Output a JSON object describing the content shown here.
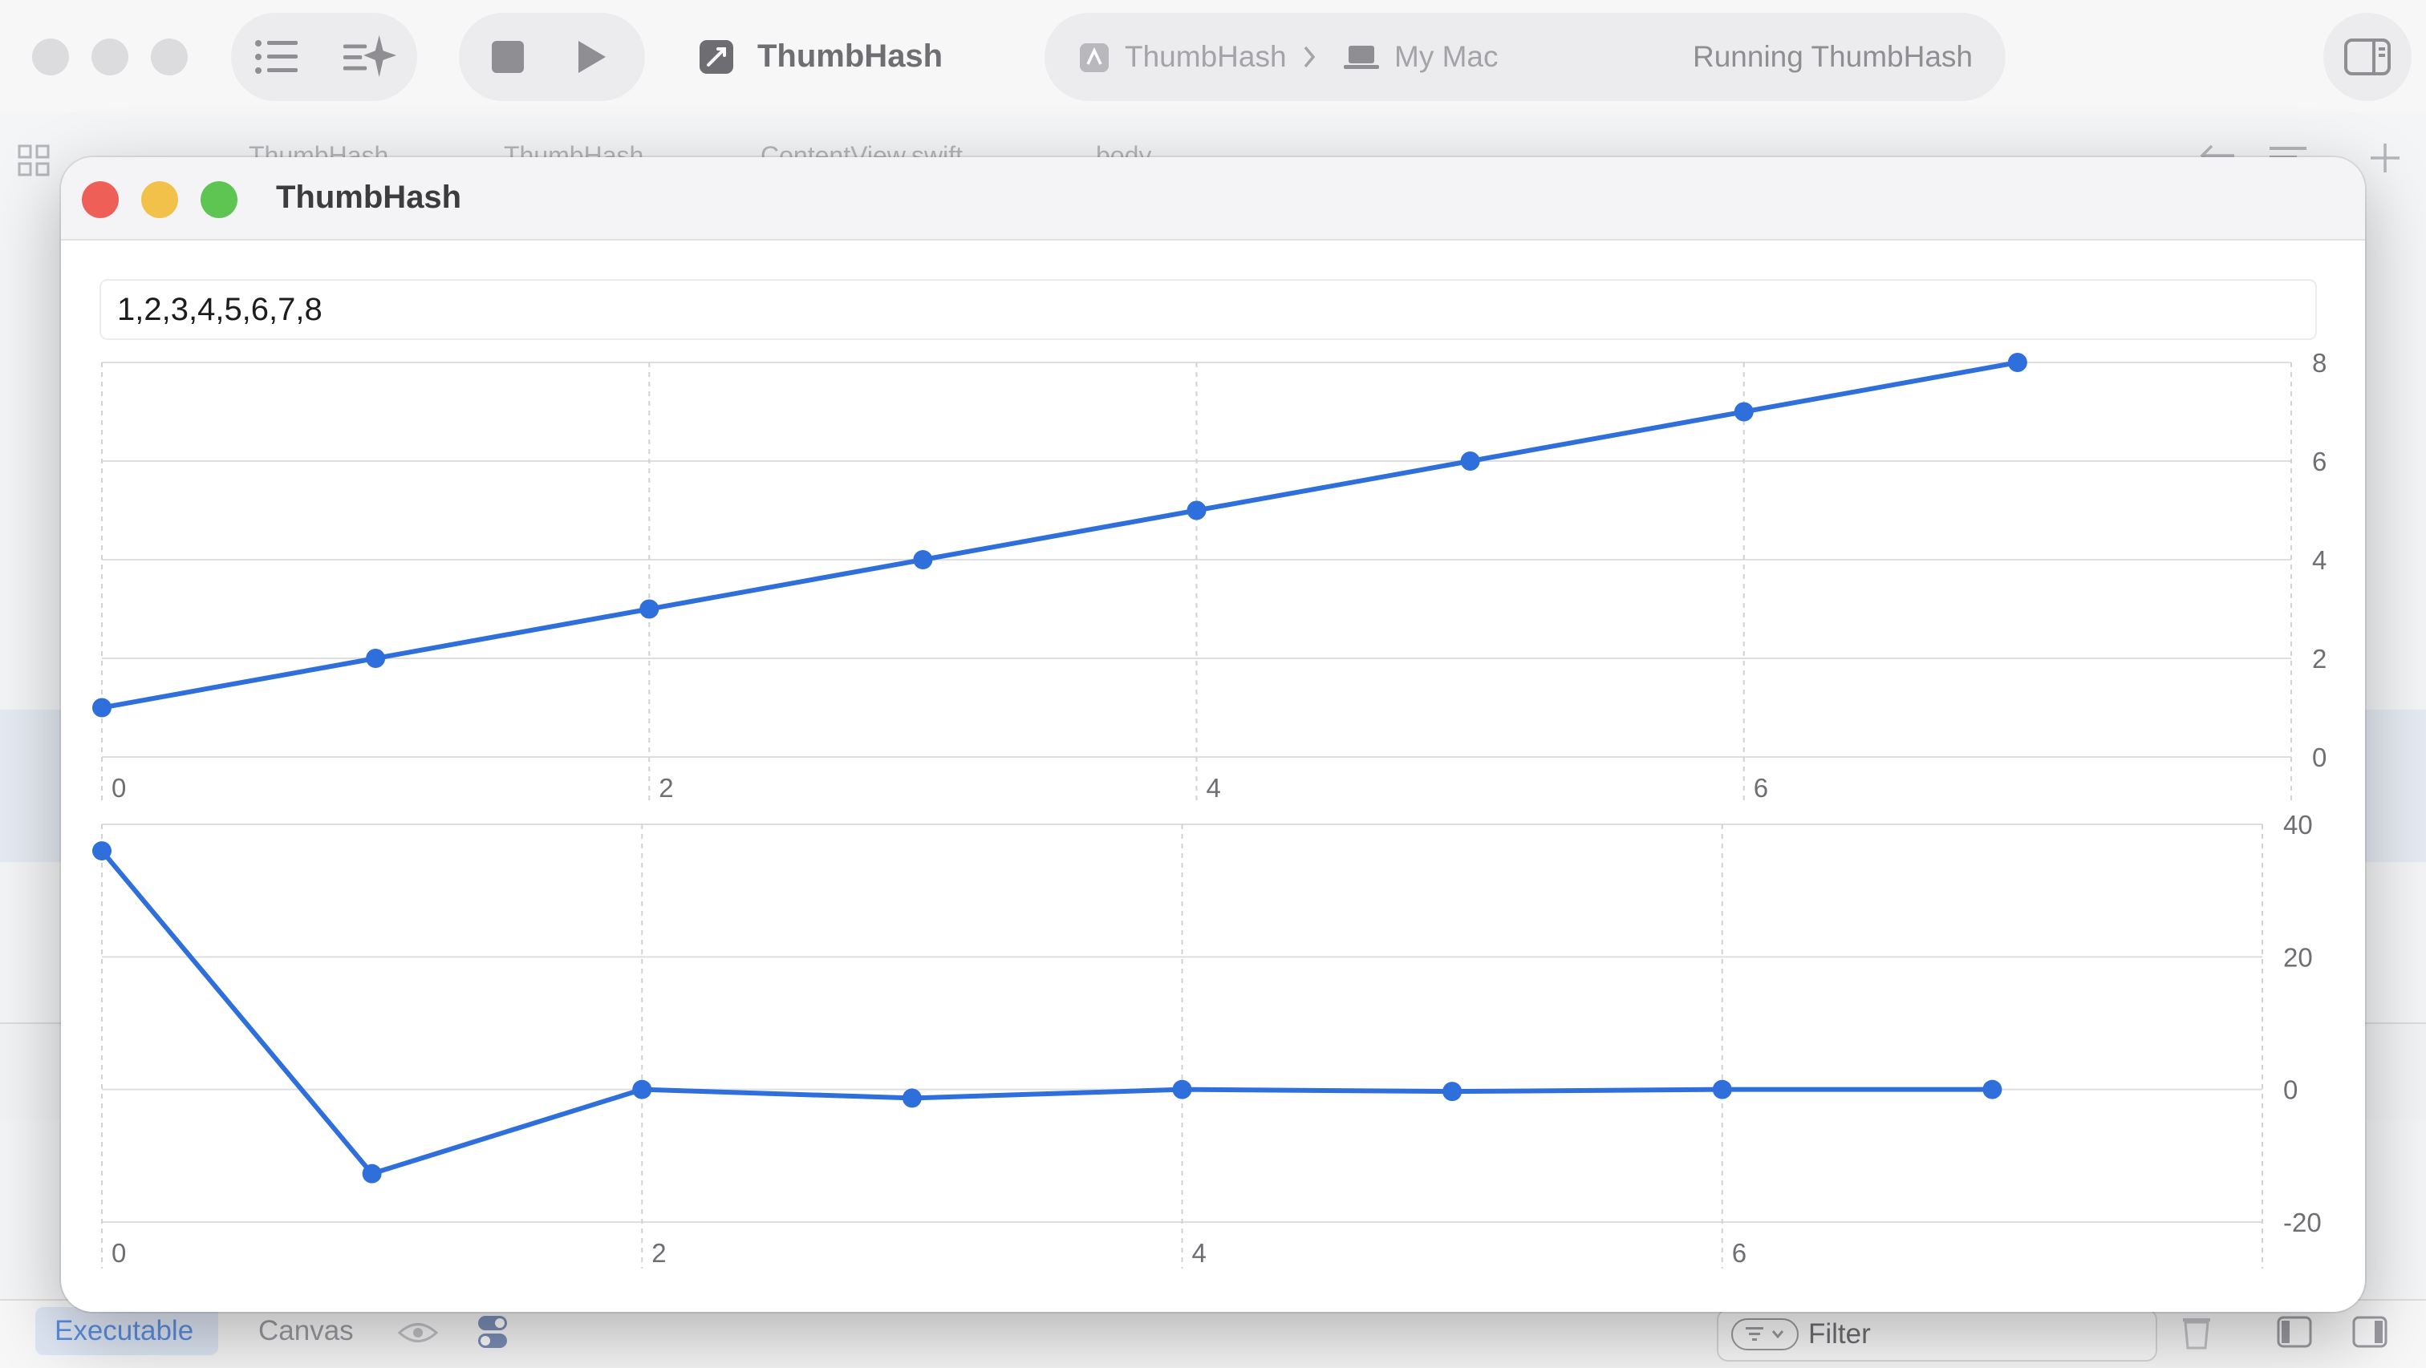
{
  "xcode": {
    "scheme_name": "ThumbHash",
    "destination_target": "ThumbHash",
    "destination_device": "My Mac",
    "status_text": "Running ThumbHash",
    "breadcrumb": [
      "ThumbHash",
      "ThumbHash",
      "ContentView.swift",
      "body"
    ],
    "bottom_bar": {
      "executable_label": "Executable",
      "canvas_label": "Canvas",
      "filter_placeholder": "Filter"
    },
    "colors": {
      "close": "#ed5f57",
      "minimize": "#f2c14a",
      "zoom": "#5ec452",
      "accent": "#2f6fdc"
    }
  },
  "app_window": {
    "title": "ThumbHash",
    "values_input": "1,2,3,4,5,6,7,8"
  },
  "chart_data": [
    {
      "type": "line",
      "x": [
        0,
        1,
        2,
        3,
        4,
        5,
        6,
        7
      ],
      "series": [
        {
          "values": [
            1,
            2,
            3,
            4,
            5,
            6,
            7,
            8
          ]
        }
      ],
      "x_ticks": [
        "0",
        "2",
        "4",
        "6"
      ],
      "y_ticks": [
        "0",
        "2",
        "4",
        "6",
        "8"
      ],
      "xlabel": "",
      "ylabel": "",
      "xlim": [
        0,
        8
      ],
      "ylim": [
        0,
        8
      ],
      "y_axis_side": "right",
      "grid": true,
      "color": "#2f6fdc"
    },
    {
      "type": "line",
      "x": [
        0,
        1,
        2,
        3,
        4,
        5,
        6,
        7
      ],
      "series": [
        {
          "values": [
            36,
            -12.7,
            0,
            -1.3,
            0,
            -0.3,
            0,
            0
          ]
        }
      ],
      "x_ticks": [
        "0",
        "2",
        "4",
        "6"
      ],
      "y_ticks": [
        "-20",
        "0",
        "20",
        "40"
      ],
      "xlabel": "",
      "ylabel": "",
      "xlim": [
        0,
        8
      ],
      "ylim": [
        -20,
        40
      ],
      "y_axis_side": "right",
      "grid": true,
      "color": "#2f6fdc"
    }
  ]
}
